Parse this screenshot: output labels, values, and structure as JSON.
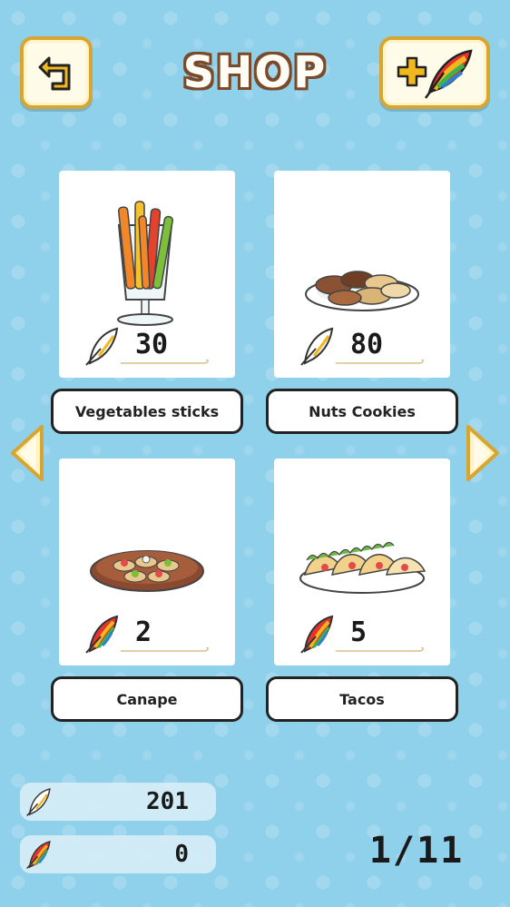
{
  "header": {
    "title": "SHOP",
    "back_icon": "back-arrow-icon",
    "add_feather_icon": "plus-rainbow-feather-icon"
  },
  "items": [
    {
      "name": "Vegetables sticks",
      "price": "30",
      "currency": "white-feather"
    },
    {
      "name": "Nuts Cookies",
      "price": "80",
      "currency": "white-feather"
    },
    {
      "name": "Canape",
      "price": "2",
      "currency": "rainbow-feather"
    },
    {
      "name": "Tacos",
      "price": "5",
      "currency": "rainbow-feather"
    }
  ],
  "wallet": {
    "white_feathers": "201",
    "rainbow_feathers": "0"
  },
  "pagination": {
    "label": "1/11"
  },
  "colors": {
    "background": "#8fd0ea",
    "button_border": "#d9a531",
    "title_outline": "#7a4a2b"
  }
}
